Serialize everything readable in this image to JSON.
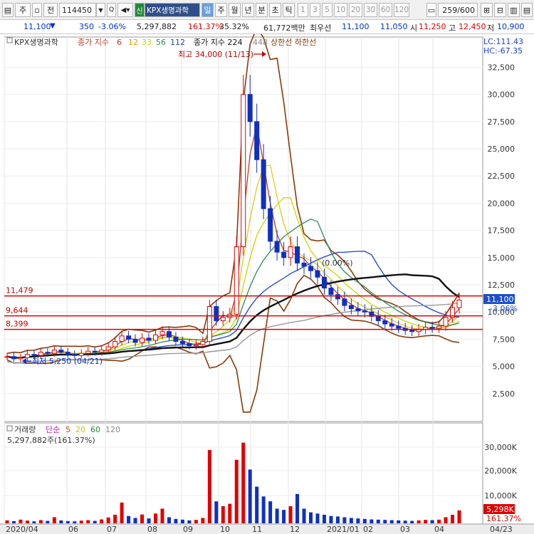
{
  "toolbar": {
    "buttons": [
      "",
      "주",
      "",
      "전"
    ],
    "code": "114450",
    "name": "KPX생명과학",
    "shin": "신",
    "periods": [
      "일",
      "주",
      "월",
      "년",
      "분",
      "초",
      "틱"
    ],
    "numbers": [
      "1",
      "3",
      "5",
      "10",
      "20",
      "30",
      "60",
      "120"
    ],
    "count": "259/600"
  },
  "quote": {
    "price": "11,100",
    "change": "350",
    "change_pct": "-3.06%",
    "volume": "5,297,882",
    "volume_ratio": "161.37%",
    "turnover": "35.32%",
    "amount": "61,772백만",
    "best_label": "최우선",
    "ask": "11,100",
    "bid": "11,050",
    "open_label": "시",
    "open": "11,250",
    "high_label": "고",
    "high": "12,450",
    "low_label": "저",
    "low": "10,900",
    "colors": {
      "up": "#e00000",
      "down": "#0033cc"
    }
  },
  "chart_data": {
    "type": "candlestick",
    "price_legend": {
      "name": "KPX생명과학",
      "ma_label": "종가 지수",
      "ma_periods": [
        "6",
        "12",
        "33",
        "56",
        "112"
      ],
      "ma_colors": [
        "#c0392b",
        "#e8c81a",
        "#c8d800",
        "#2e8b57",
        "#2040d0"
      ],
      "long_ma_label": "종가 지수 224",
      "long_ma2": "448",
      "band_label": "상한선 하한선"
    },
    "y_axis": [
      "32,500",
      "30,000",
      "27,500",
      "25,000",
      "22,500",
      "20,000",
      "17,500",
      "15,000",
      "12,500",
      "10,000",
      "7,500",
      "5,000",
      "2,500"
    ],
    "ylim": [
      0,
      35000
    ],
    "right_labels": {
      "lc": "LC:111.43",
      "hc": "HC:-67.35",
      "price": "11,100",
      "pct": "-3.06%"
    },
    "hlines": [
      {
        "label": "11,479",
        "value": 11479
      },
      {
        "label": "9,644",
        "value": 9644
      },
      {
        "label": "8,399",
        "value": 8399
      }
    ],
    "high_note": "최고 34,000 (11/13)",
    "high_value": 34000,
    "low_note": "최저 5,250 (04/21)",
    "low_value": 5250,
    "pct_note": "(0.00%)",
    "close": [
      5900,
      5700,
      5800,
      6100,
      6000,
      6300,
      6200,
      6500,
      6300,
      6100,
      6000,
      6200,
      6400,
      6300,
      6500,
      6800,
      7300,
      7800,
      7500,
      7200,
      7600,
      7400,
      7900,
      8200,
      7700,
      7300,
      7100,
      6900,
      7000,
      7300,
      10500,
      9200,
      9500,
      9800,
      16000,
      30000,
      27500,
      24000,
      19500,
      16500,
      15500,
      15000,
      16000,
      14500,
      14200,
      13800,
      13200,
      12200,
      11600,
      11200,
      10600,
      10300,
      10100,
      10000,
      9600,
      9200,
      8900,
      8700,
      8500,
      8300,
      8200,
      8400,
      8600,
      8500,
      8700,
      9500,
      10400,
      11100
    ],
    "volume": {
      "label": "거래량",
      "ma_label": "단순",
      "ma_periods": [
        "5",
        "20",
        "60",
        "120"
      ],
      "ma_colors": [
        "#d05010",
        "#c8c800",
        "#208040",
        "#888888"
      ],
      "summary": "5,297,882주(161.37%)",
      "y_axis": [
        "30,000K",
        "20,000K",
        "10,000K"
      ],
      "ylim": [
        0,
        35000
      ],
      "current": "5,298K",
      "current_pct": "161.37%"
    },
    "x_axis": [
      "2020/04",
      "06",
      "07",
      "08",
      "09",
      "10",
      "11",
      "12",
      "2021/01",
      "02",
      "03",
      "04"
    ],
    "x_right": "04/23"
  }
}
